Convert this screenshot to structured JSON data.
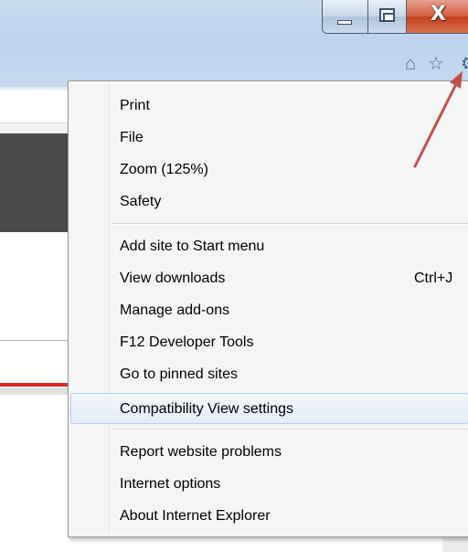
{
  "window": {
    "minimize_icon": "minimize-icon",
    "restore_icon": "restore-icon",
    "close_glyph": "X"
  },
  "toolbar": {
    "icons": [
      "home-icon",
      "star-icon",
      "gear-icon"
    ],
    "home_glyph": "⌂",
    "star_glyph": "☆",
    "gear_glyph": "⚙"
  },
  "menu": {
    "group1": [
      {
        "label": "Print"
      },
      {
        "label": "File"
      },
      {
        "label": "Zoom (125%)"
      },
      {
        "label": "Safety"
      }
    ],
    "group2": [
      {
        "label": "Add site to Start menu"
      },
      {
        "label": "View downloads",
        "shortcut": "Ctrl+J"
      },
      {
        "label": "Manage add-ons"
      },
      {
        "label": "F12 Developer Tools"
      },
      {
        "label": "Go to pinned sites"
      },
      {
        "label": "Compatibility View settings",
        "highlighted": true
      }
    ],
    "group3": [
      {
        "label": "Report website problems"
      },
      {
        "label": "Internet options"
      },
      {
        "label": "About Internet Explorer"
      }
    ]
  },
  "colors": {
    "annotation_arrow": "#c0504d",
    "title_bar": "#bcd3ec",
    "close_button": "#c2401f",
    "highlight_border": "#aecdef"
  }
}
